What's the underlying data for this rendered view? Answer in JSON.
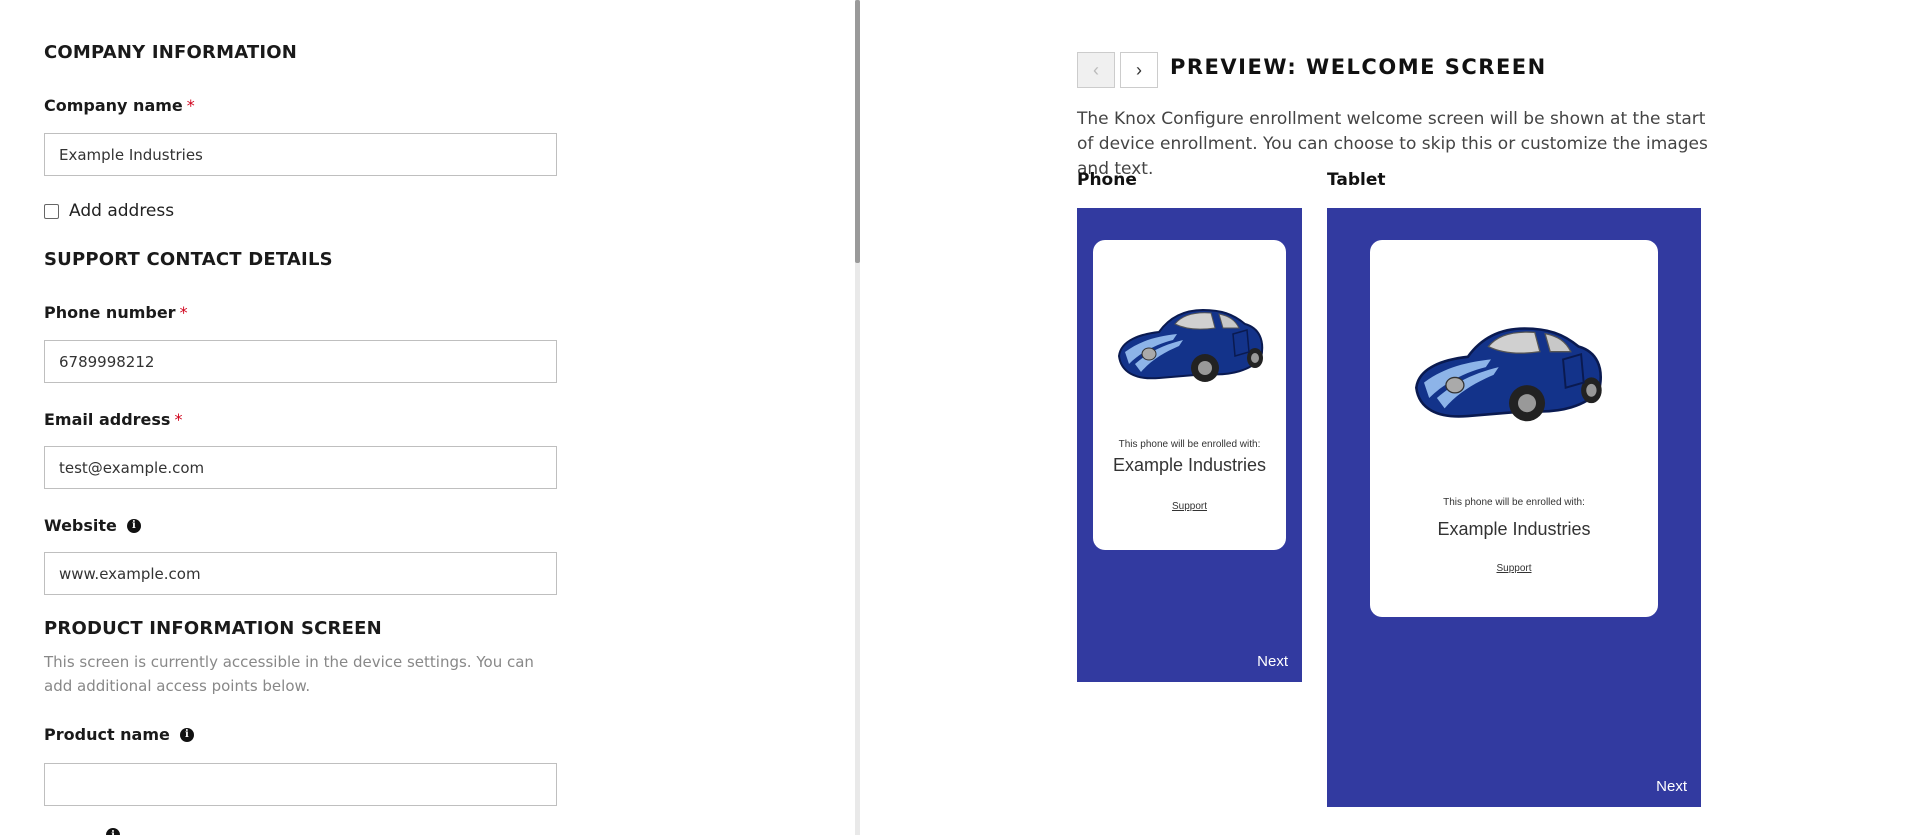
{
  "company_section": {
    "title": "COMPANY INFORMATION",
    "company_name_label": "Company name",
    "company_name_value": "Example Industries",
    "add_address_label": "Add address"
  },
  "support_section": {
    "title": "SUPPORT CONTACT DETAILS",
    "phone_label": "Phone number",
    "phone_value": "6789998212",
    "email_label": "Email address",
    "email_value": "test@example.com",
    "website_label": "Website",
    "website_value": "www.example.com"
  },
  "product_section": {
    "title": "PRODUCT INFORMATION SCREEN",
    "helper": "This screen is currently accessible in the device settings. You can add additional access points below.",
    "product_name_label": "Product name",
    "product_name_value": ""
  },
  "required_mark": "*",
  "info_icon_glyph": "i",
  "preview": {
    "prev_glyph": "‹",
    "next_glyph": "›",
    "title": "PREVIEW: WELCOME SCREEN",
    "description": "The Knox Configure enrollment welcome screen will be shown at the start of device enrollment. You can choose to skip this or customize the images and text.",
    "phone_label": "Phone",
    "tablet_label": "Tablet",
    "phone": {
      "enroll_text": "This phone will be enrolled with:",
      "company": "Example Industries",
      "support": "Support",
      "next": "Next"
    },
    "tablet": {
      "enroll_text": "This phone will be enrolled with:",
      "company": "Example Industries",
      "support": "Support",
      "next": "Next"
    }
  },
  "colors": {
    "device_background": "#323aa0",
    "required": "#d0021b",
    "car_body": "#13338a"
  }
}
